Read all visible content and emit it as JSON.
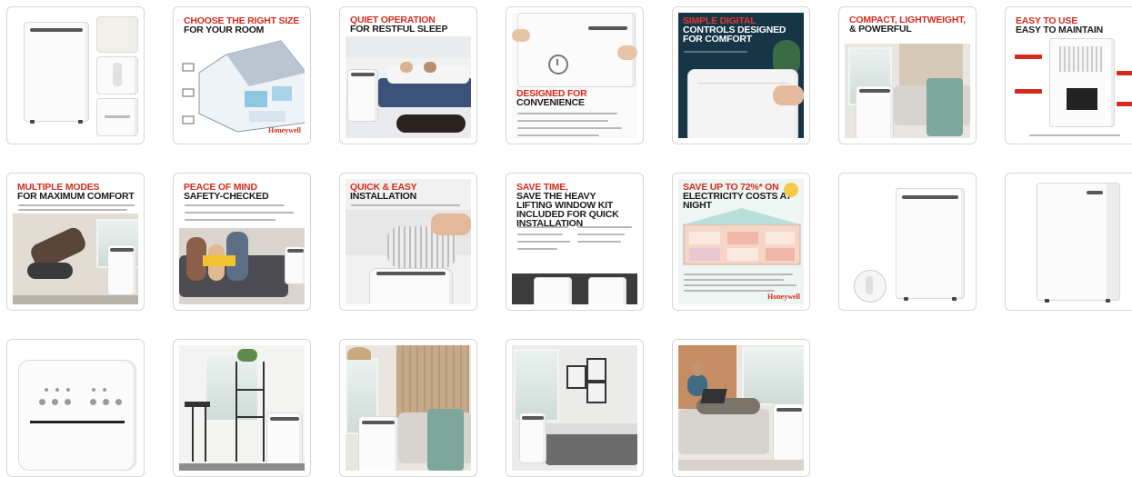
{
  "gallery": {
    "tiles": [
      {
        "id": "t01",
        "kind": "product-collage"
      },
      {
        "id": "t02",
        "kind": "infographic",
        "headline_red": "CHOOSE THE RIGHT SIZE",
        "headline_black": "FOR YOUR ROOM",
        "brand": "Honeywell"
      },
      {
        "id": "t03",
        "kind": "lifestyle",
        "headline_red": "QUIET OPERATION",
        "headline_black": "FOR RESTFUL SLEEP"
      },
      {
        "id": "t04",
        "kind": "infographic",
        "headline_red": "DESIGNED FOR",
        "headline_black": "CONVENIENCE"
      },
      {
        "id": "t05",
        "kind": "lifestyle",
        "headline_red": "SIMPLE DIGITAL",
        "headline_black": "CONTROLS DESIGNED FOR COMFORT"
      },
      {
        "id": "t06",
        "kind": "lifestyle",
        "headline_red": "COMPACT, LIGHTWEIGHT,",
        "headline_black": "& POWERFUL"
      },
      {
        "id": "t07",
        "kind": "infographic",
        "headline_red": "EASY TO USE",
        "headline_black": "EASY TO MAINTAIN"
      },
      {
        "id": "t08",
        "kind": "lifestyle",
        "headline_red": "MULTIPLE MODES",
        "headline_black": "FOR MAXIMUM COMFORT"
      },
      {
        "id": "t09",
        "kind": "lifestyle",
        "headline_red": "PEACE OF MIND",
        "headline_black": "SAFETY-CHECKED"
      },
      {
        "id": "t10",
        "kind": "lifestyle",
        "headline_red": "QUICK & EASY",
        "headline_black": "INSTALLATION"
      },
      {
        "id": "t11",
        "kind": "infographic",
        "headline_red": "SAVE TIME,",
        "headline_black": "SAVE THE HEAVY LIFTING WINDOW KIT INCLUDED FOR QUICK INSTALLATION"
      },
      {
        "id": "t12",
        "kind": "infographic",
        "headline_red": "SAVE UP TO 72%* ON",
        "headline_black": "ELECTRICITY COSTS AT NIGHT",
        "brand": "Honeywell"
      },
      {
        "id": "t13",
        "kind": "product-remote"
      },
      {
        "id": "t14",
        "kind": "product-angle"
      },
      {
        "id": "t15",
        "kind": "control-panel"
      },
      {
        "id": "t16",
        "kind": "lifestyle-kitchen"
      },
      {
        "id": "t17",
        "kind": "lifestyle-livingroom"
      },
      {
        "id": "t18",
        "kind": "lifestyle-bedroom"
      },
      {
        "id": "t19",
        "kind": "lifestyle-sofa"
      }
    ]
  },
  "colors": {
    "accent_red": "#d52b1e",
    "border": "#d6d6d6",
    "background": "#ffffff"
  },
  "icons": [
    "power-icon",
    "product-icon"
  ]
}
